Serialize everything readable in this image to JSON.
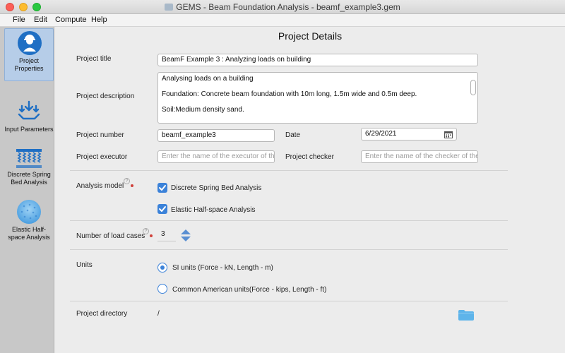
{
  "window": {
    "title": "GEMS - Beam Foundation Analysis - beamf_example3.gem"
  },
  "menu": {
    "file": "File",
    "edit": "Edit",
    "compute": "Compute",
    "help": "Help"
  },
  "sidebar": {
    "items": [
      {
        "label": "Project Properties",
        "icon": "engineer-icon"
      },
      {
        "label": "Input Parameters",
        "icon": "download-arrows-icon"
      },
      {
        "label": "Discrete Spring Bed Analysis",
        "icon": "spring-bed-icon"
      },
      {
        "label": "Elastic Half-space Analysis",
        "icon": "half-space-icon"
      }
    ]
  },
  "main": {
    "title": "Project Details",
    "project_title": {
      "label": "Project title",
      "value": "BeamF Example 3 : Analyzing loads on building"
    },
    "project_description": {
      "label": "Project description",
      "lines": [
        "Analysing loads on a building",
        "Foundation: Concrete beam foundation with 10m long, 1.5m wide and 0.5m deep.",
        "Soil:Medium density sand."
      ]
    },
    "project_number": {
      "label": "Project number",
      "value": "beamf_example3"
    },
    "date": {
      "label": "Date",
      "value": "6/29/2021"
    },
    "project_executor": {
      "label": "Project executor",
      "placeholder": "Enter the name of the executor of the"
    },
    "project_checker": {
      "label": "Project checker",
      "placeholder": "Enter the name of the checker of the p"
    },
    "analysis_model": {
      "label": "Analysis model",
      "options": [
        {
          "label": "Discrete Spring Bed Analysis",
          "checked": true
        },
        {
          "label": "Elastic Half-space Analysis",
          "checked": true
        }
      ]
    },
    "load_cases": {
      "label": "Number of load cases",
      "value": "3"
    },
    "units": {
      "label": "Units",
      "options": [
        {
          "label": "SI units (Force - kN, Length - m)",
          "selected": true
        },
        {
          "label": "Common American units(Force - kips, Length - ft)",
          "selected": false
        }
      ]
    },
    "project_directory": {
      "label": "Project directory",
      "value": "/"
    }
  },
  "colors": {
    "accent": "#3b82d9",
    "required": "#d0413b",
    "folder": "#5eb4ea",
    "sidebar_active": "#b6cde8"
  }
}
